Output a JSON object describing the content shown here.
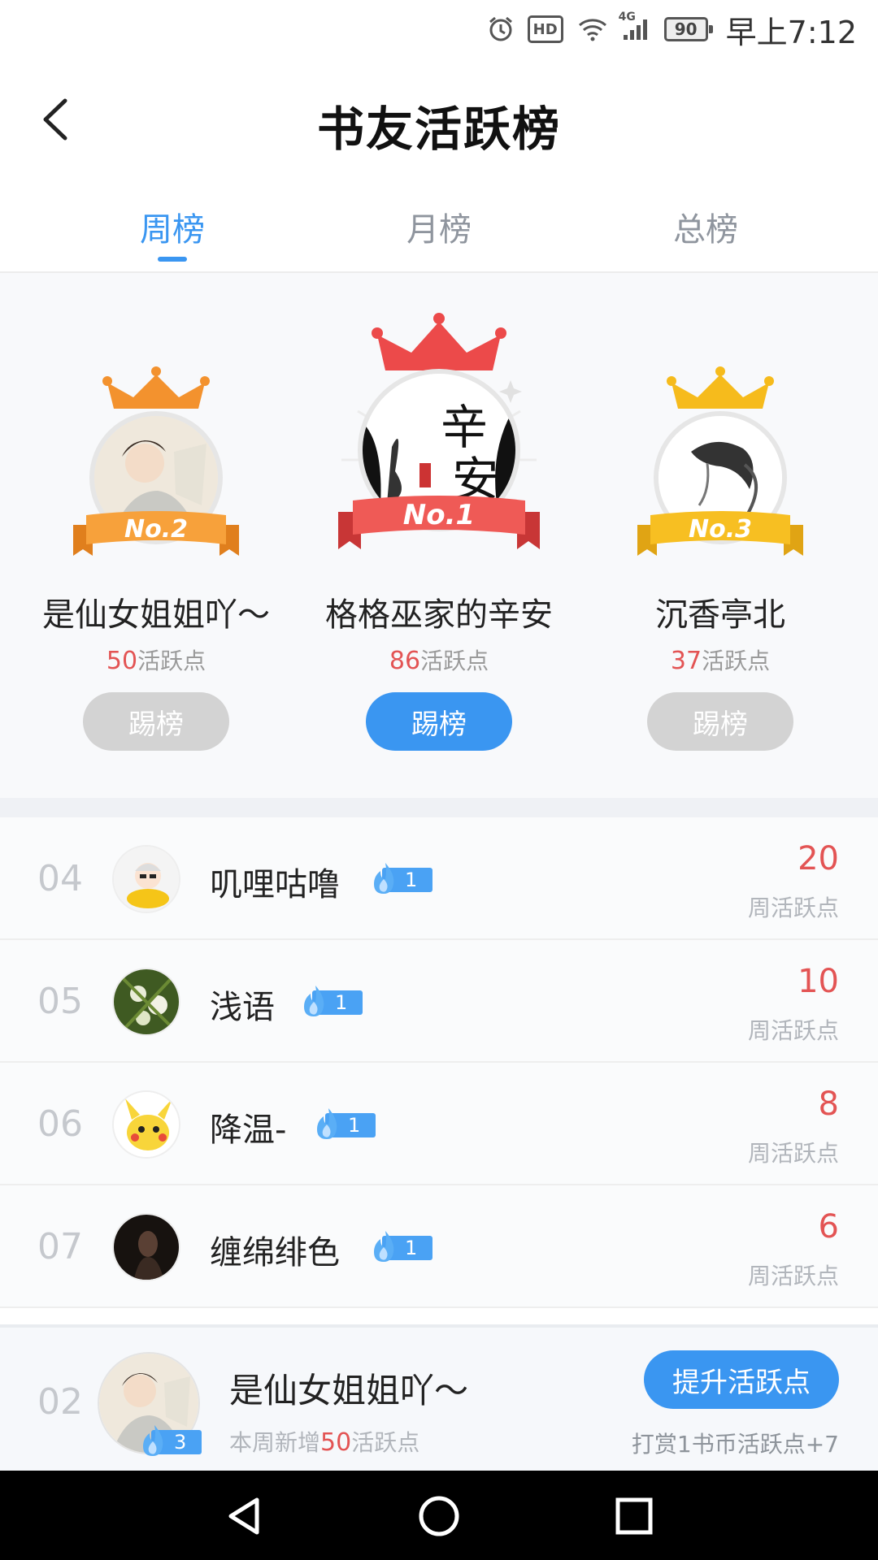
{
  "status_bar": {
    "time": "早上7:12",
    "battery": "90",
    "hd": "HD",
    "network": "4G",
    "icons": [
      "alarm-icon",
      "hd-icon",
      "wifi-icon",
      "signal-icon",
      "battery-icon"
    ]
  },
  "header": {
    "title": "书友活跃榜",
    "back_icon": "chevron-left-icon"
  },
  "tabs": [
    {
      "label": "周榜",
      "active": true
    },
    {
      "label": "月榜",
      "active": false
    },
    {
      "label": "总榜",
      "active": false
    }
  ],
  "podium": [
    {
      "rank_label": "No.2",
      "name": "是仙女姐姐吖～",
      "points": "50",
      "points_suffix": "活跃点",
      "button": "踢榜",
      "crown_color": "#f3922e",
      "ribbon_color": "#f7a13b"
    },
    {
      "rank_label": "No.1",
      "name": "格格巫家的辛安",
      "points": "86",
      "points_suffix": "活跃点",
      "button": "踢榜",
      "crown_color": "#ec4a4a",
      "ribbon_color": "#ef5a56"
    },
    {
      "rank_label": "No.3",
      "name": "沉香亭北",
      "points": "37",
      "points_suffix": "活跃点",
      "button": "踢榜",
      "crown_color": "#f6bb1c",
      "ribbon_color": "#f7bf22"
    }
  ],
  "list": [
    {
      "rank": "04",
      "name": "叽哩咕噜",
      "level": "1",
      "value": "20",
      "sub": "周活跃点"
    },
    {
      "rank": "05",
      "name": "浅语",
      "level": "1",
      "value": "10",
      "sub": "周活跃点"
    },
    {
      "rank": "06",
      "name": "降温-",
      "level": "1",
      "value": "8",
      "sub": "周活跃点"
    },
    {
      "rank": "07",
      "name": "缠绵绯色",
      "level": "1",
      "value": "6",
      "sub": "周活跃点"
    }
  ],
  "me": {
    "rank": "02",
    "name": "是仙女姐姐吖～",
    "level": "3",
    "sub_prefix": "本周新增",
    "sub_num": "50",
    "sub_suffix": "活跃点",
    "button": "提升活跃点",
    "tip": "打赏1书币活跃点+7"
  },
  "colors": {
    "accent": "#3a96f1",
    "points_red": "#e35454",
    "muted": "#b1b5bb"
  }
}
